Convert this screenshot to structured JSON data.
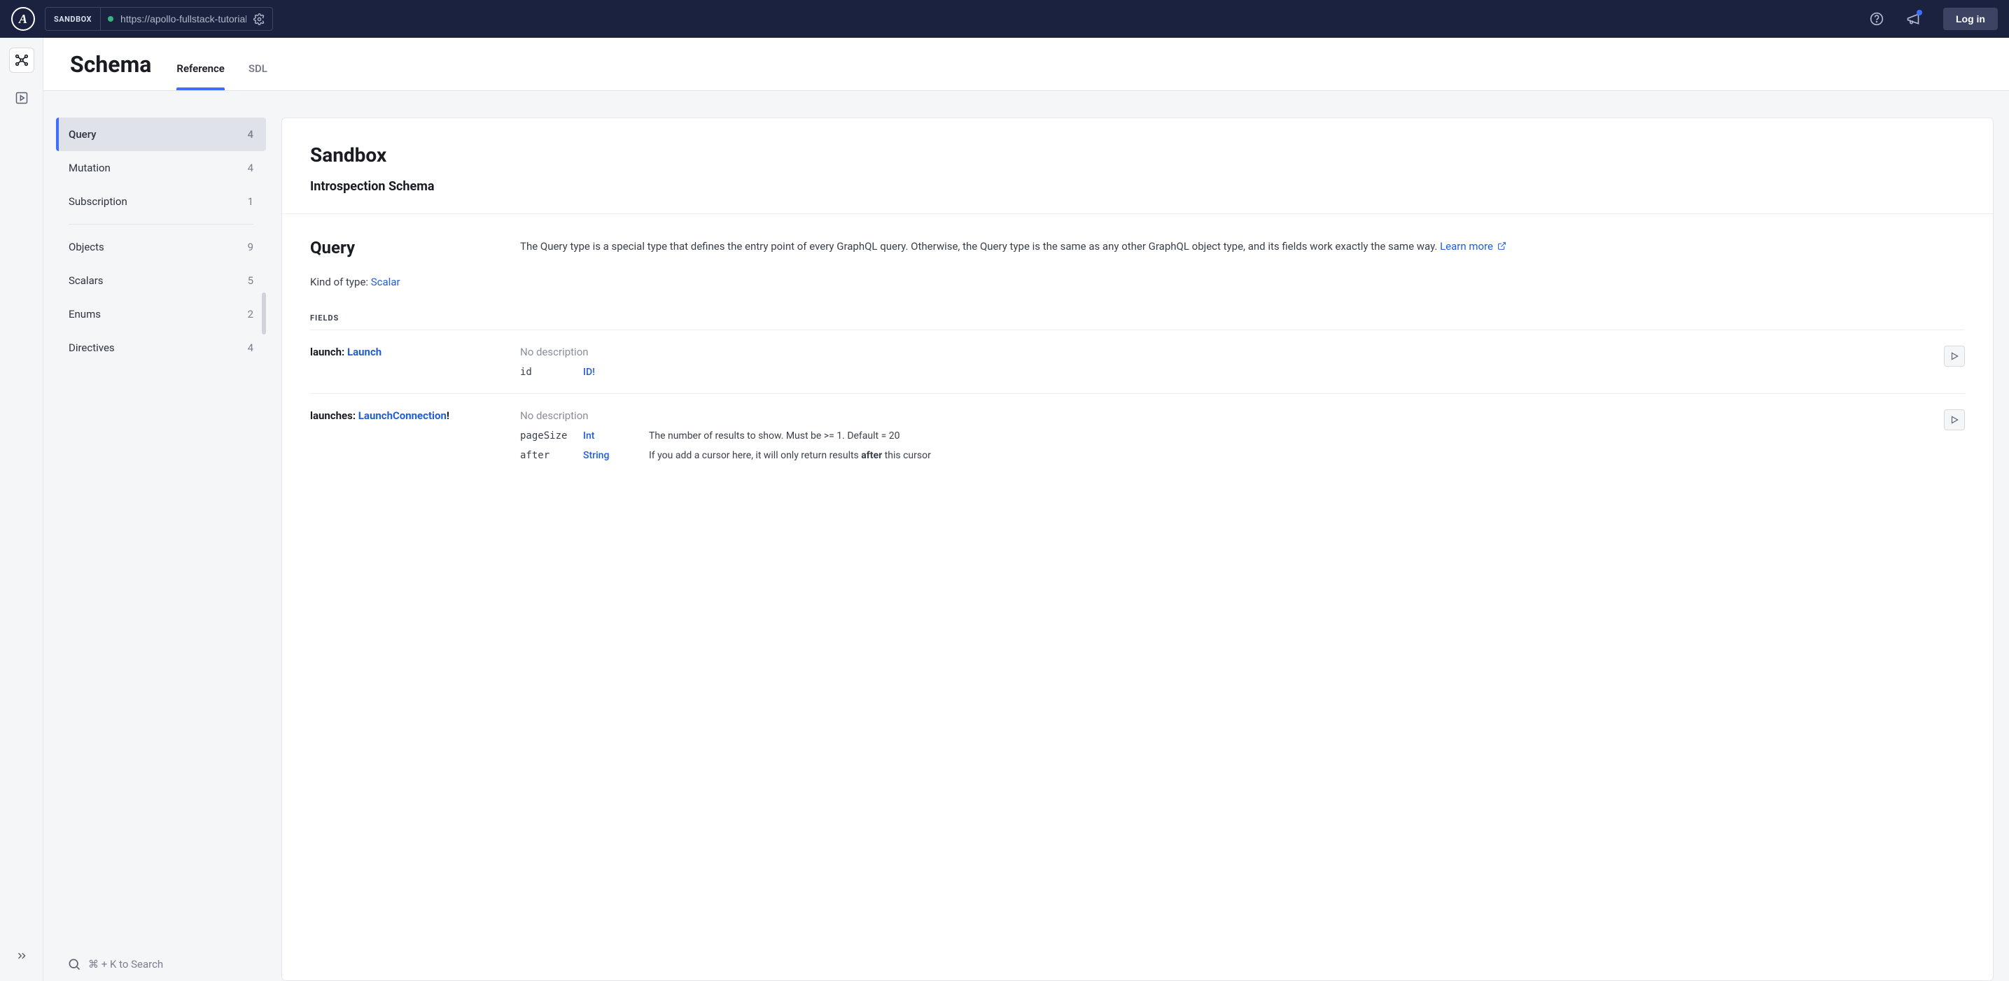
{
  "header": {
    "sandbox_label": "SANDBOX",
    "endpoint_url": "https://apollo-fullstack-tutorial",
    "login_label": "Log in"
  },
  "page": {
    "title": "Schema",
    "tabs": [
      {
        "label": "Reference",
        "active": true
      },
      {
        "label": "SDL",
        "active": false
      }
    ]
  },
  "sidebar": {
    "groups": [
      [
        {
          "label": "Query",
          "count": "4",
          "active": true
        },
        {
          "label": "Mutation",
          "count": "4"
        },
        {
          "label": "Subscription",
          "count": "1"
        }
      ],
      [
        {
          "label": "Objects",
          "count": "9"
        },
        {
          "label": "Scalars",
          "count": "5"
        },
        {
          "label": "Enums",
          "count": "2"
        },
        {
          "label": "Directives",
          "count": "4"
        }
      ]
    ],
    "search_hint": "⌘ + K to Search"
  },
  "detail": {
    "title": "Sandbox",
    "subtitle": "Introspection Schema",
    "type_name": "Query",
    "type_desc_1": "The Query type is a special type that defines the entry point of every GraphQL query. Otherwise, the Query type is the same as any other GraphQL object type, and its fields work exactly the same way. ",
    "learn_more": "Learn more",
    "kind_label": "Kind of type: ",
    "kind_value": "Scalar",
    "fields_heading": "FIELDS",
    "fields": [
      {
        "name": "launch",
        "return_type": "Launch",
        "bang": "",
        "no_desc": "No description",
        "args": [
          {
            "name": "id",
            "type": "ID",
            "bang": "!",
            "desc": ""
          }
        ]
      },
      {
        "name": "launches",
        "return_type": "LaunchConnection",
        "bang": "!",
        "no_desc": "No description",
        "args": [
          {
            "name": "pageSize",
            "type": "Int",
            "bang": "",
            "desc": "The number of results to show. Must be >= 1. Default = 20"
          },
          {
            "name": "after",
            "type": "String",
            "bang": "",
            "desc_pre": "If you add a cursor here, it will only return results ",
            "desc_bold": "after",
            "desc_post": " this cursor"
          }
        ]
      }
    ]
  }
}
